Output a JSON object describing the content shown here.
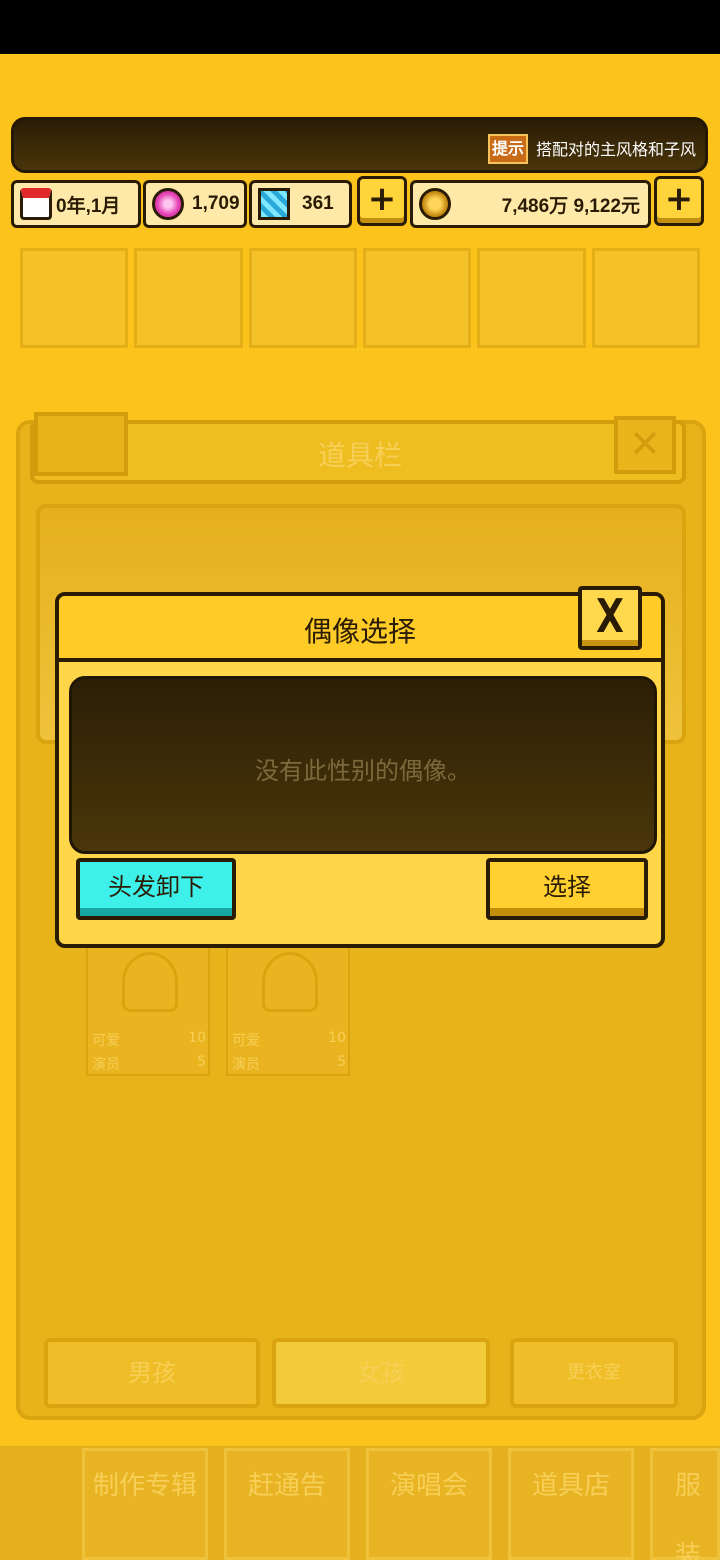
{
  "ticker": {
    "tip_badge": "提示",
    "tip_text": "搭配对的主风格和子风"
  },
  "resources": {
    "date": "0年,1月",
    "gems": "1,709",
    "diamonds": "361",
    "money": "7,486万 9,122元",
    "plus": "+"
  },
  "background": {
    "panel_title": "道具栏",
    "close": "✕",
    "cards": [
      {
        "stat1_label": "可爱",
        "stat1_value": "10",
        "stat2_label": "演员",
        "stat2_value": "5"
      },
      {
        "stat1_label": "可爱",
        "stat1_value": "10",
        "stat2_label": "演员",
        "stat2_value": "5"
      }
    ],
    "tabs": {
      "boy": "男孩",
      "girl": "女孩",
      "wardrobe": "更衣室"
    },
    "nav": [
      "制作专辑",
      "赶通告",
      "演唱会",
      "道具店",
      "服装"
    ]
  },
  "modal": {
    "title": "偶像选择",
    "close": "X",
    "empty_message": "没有此性别的偶像。",
    "hair_remove_label": "头发卸下",
    "select_label": "选择"
  },
  "colors": {
    "background": "#fbc31c",
    "modal": "#ffd54a",
    "hair_button": "#3ef0ea",
    "dark": "#2a1c04"
  }
}
